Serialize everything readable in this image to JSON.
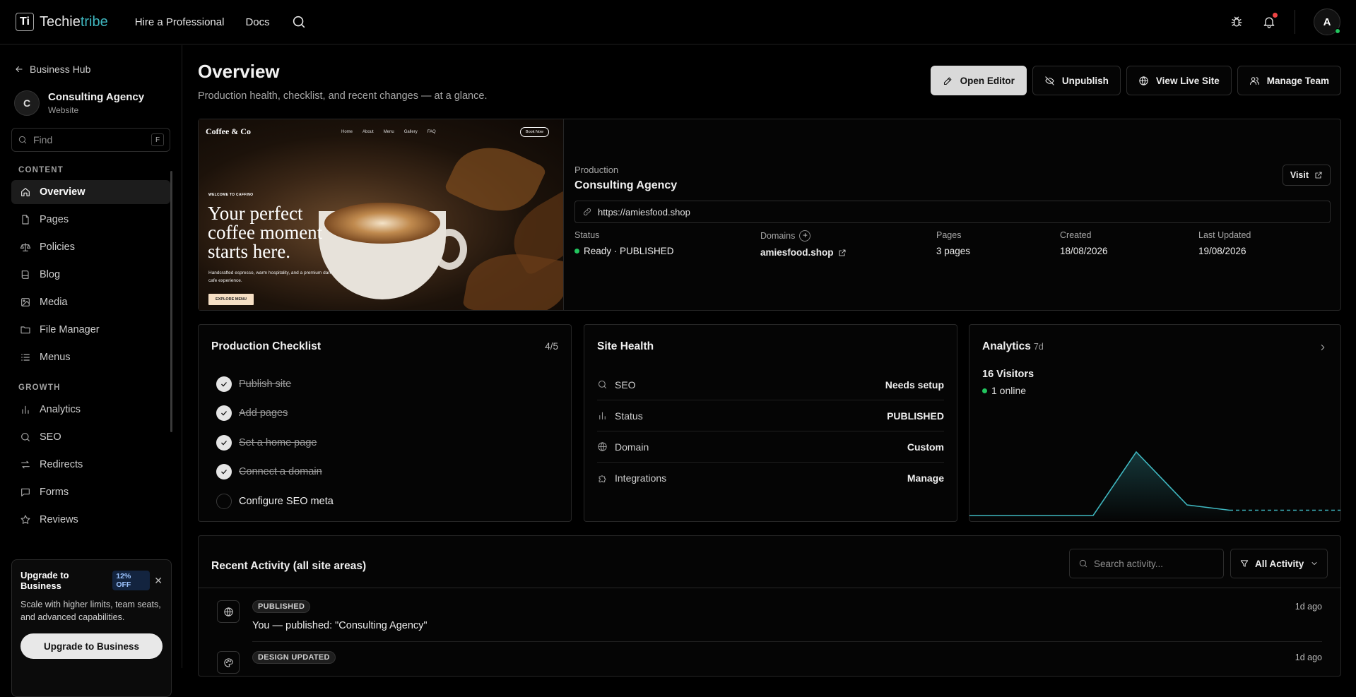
{
  "topbar": {
    "logo_a": "Techie",
    "logo_b": "tribe",
    "logo_mark": "Ti",
    "nav": [
      "Hire a Professional",
      "Docs"
    ],
    "avatar": "A"
  },
  "sidebar": {
    "back": "Business Hub",
    "site_initial": "C",
    "site_name": "Consulting Agency",
    "site_type": "Website",
    "find_placeholder": "Find",
    "find_key": "F",
    "content_label": "CONTENT",
    "content_items": [
      {
        "label": "Overview",
        "icon": "home-icon"
      },
      {
        "label": "Pages",
        "icon": "file-icon"
      },
      {
        "label": "Policies",
        "icon": "scale-icon"
      },
      {
        "label": "Blog",
        "icon": "book-icon"
      },
      {
        "label": "Media",
        "icon": "image-icon"
      },
      {
        "label": "File Manager",
        "icon": "folder-icon"
      },
      {
        "label": "Menus",
        "icon": "list-icon"
      }
    ],
    "growth_label": "GROWTH",
    "growth_items": [
      {
        "label": "Analytics",
        "icon": "bar-chart-icon"
      },
      {
        "label": "SEO",
        "icon": "search-icon"
      },
      {
        "label": "Redirects",
        "icon": "arrows-icon"
      },
      {
        "label": "Forms",
        "icon": "message-icon"
      },
      {
        "label": "Reviews",
        "icon": "star-icon"
      }
    ],
    "promo": {
      "title": "Upgrade to Business",
      "badge": "12% OFF",
      "text": "Scale with higher limits, team seats, and advanced capabilities.",
      "button": "Upgrade to Business"
    }
  },
  "header": {
    "title": "Overview",
    "subtitle": "Production health, checklist, and recent changes — at a glance.",
    "actions": {
      "open_editor": "Open Editor",
      "unpublish": "Unpublish",
      "view_live": "View Live Site",
      "manage_team": "Manage Team"
    }
  },
  "production": {
    "preview": {
      "brand": "Coffee & Co",
      "links": [
        "Home",
        "About",
        "Menu",
        "Gallery",
        "FAQ"
      ],
      "book": "Book Now",
      "kicker": "WELCOME TO CAFFINO",
      "headline": "Your perfect coffee moment starts here.",
      "desc": "Handcrafted espresso, warm hospitality, and a premium dark cafe experience.",
      "cta": "EXPLORE MENU"
    },
    "label": "Production",
    "name": "Consulting Agency",
    "visit": "Visit",
    "url": "https://amiesfood.shop",
    "status_label": "Status",
    "status_value": "Ready · PUBLISHED",
    "domains_label": "Domains",
    "domains_value": "amiesfood.shop",
    "pages_label": "Pages",
    "pages_value": "3 pages",
    "created_label": "Created",
    "created_value": "18/08/2026",
    "updated_label": "Last Updated",
    "updated_value": "19/08/2026"
  },
  "checklist": {
    "title": "Production Checklist",
    "count": "4/5",
    "items": [
      {
        "label": "Publish site",
        "done": true
      },
      {
        "label": "Add pages",
        "done": true
      },
      {
        "label": "Set a home page",
        "done": true
      },
      {
        "label": "Connect a domain",
        "done": true
      },
      {
        "label": "Configure SEO meta",
        "done": false
      }
    ]
  },
  "health": {
    "title": "Site Health",
    "rows": [
      {
        "label": "SEO",
        "value": "Needs setup",
        "icon": "search-icon"
      },
      {
        "label": "Status",
        "value": "PUBLISHED",
        "icon": "bar-chart-icon"
      },
      {
        "label": "Domain",
        "value": "Custom",
        "icon": "globe-icon"
      },
      {
        "label": "Integrations",
        "value": "Manage",
        "icon": "puzzle-icon"
      }
    ]
  },
  "analytics": {
    "title": "Analytics",
    "range": "7d",
    "visitors": "16 Visitors",
    "online": "1 online",
    "colors": {
      "line": "#3fb7c0"
    },
    "series": [
      0,
      0,
      0,
      0,
      12,
      2,
      1,
      1
    ]
  },
  "activity": {
    "title": "Recent Activity (all site areas)",
    "search_placeholder": "Search activity...",
    "filter": "All Activity",
    "items": [
      {
        "tag": "PUBLISHED",
        "text": "You — published: \"Consulting Agency\"",
        "time": "1d ago",
        "icon": "globe-icon"
      },
      {
        "tag": "DESIGN UPDATED",
        "text": "",
        "time": "1d ago",
        "icon": "palette-icon"
      }
    ]
  }
}
